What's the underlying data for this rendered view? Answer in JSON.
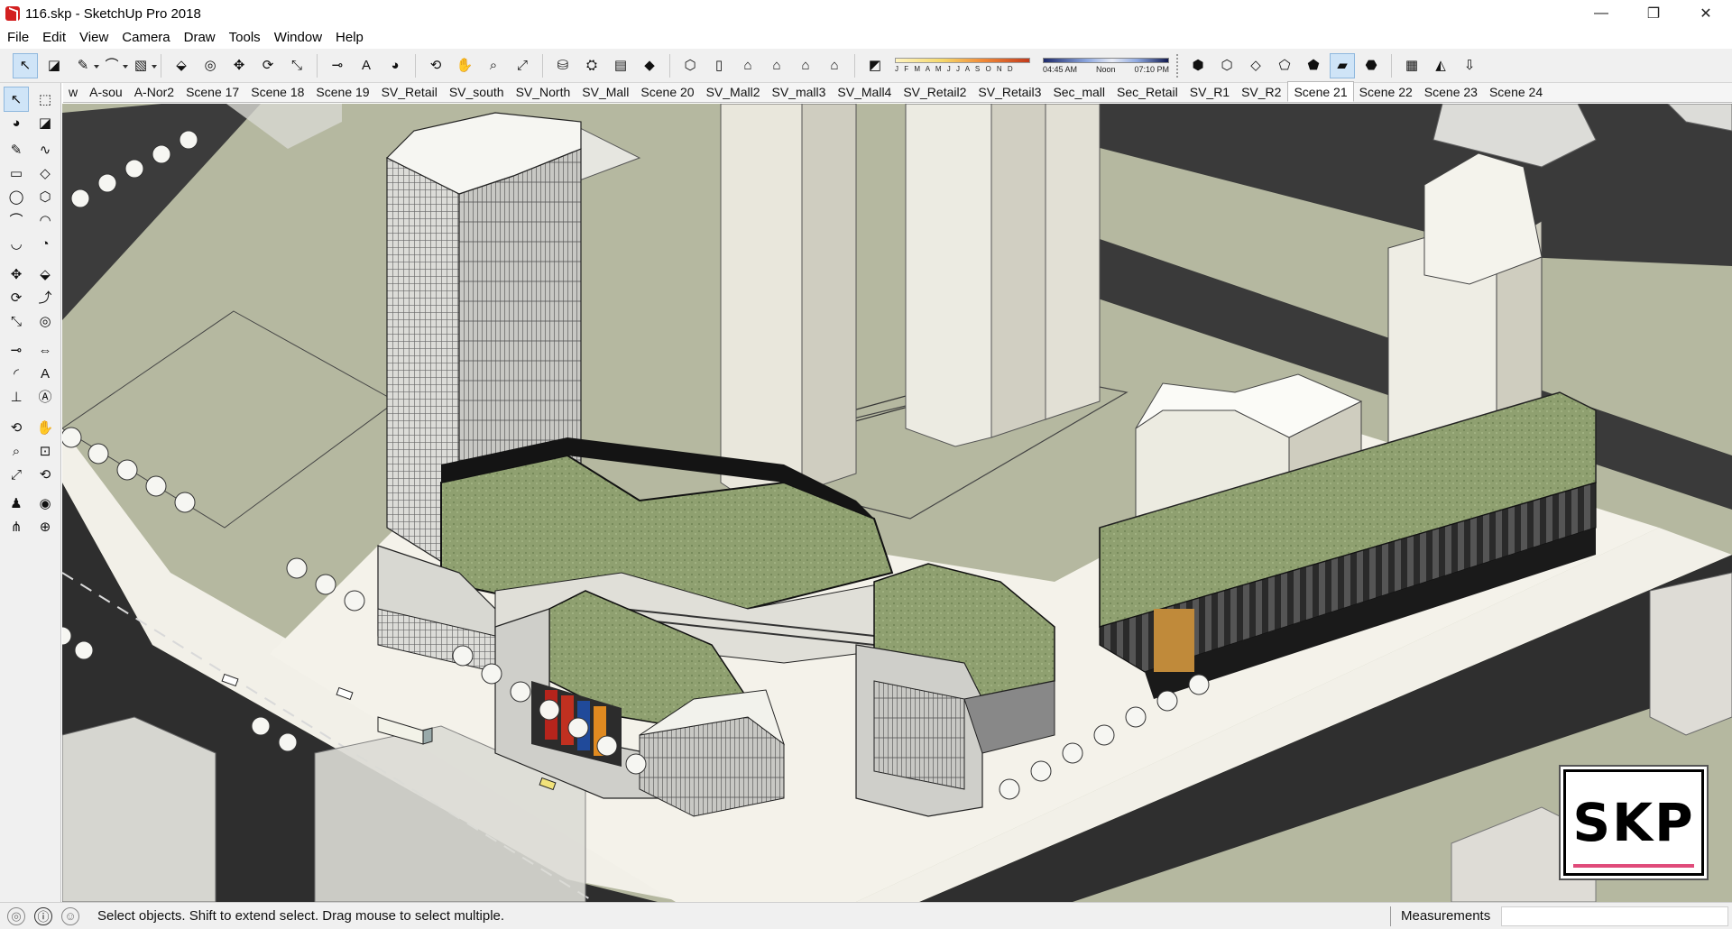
{
  "window": {
    "title": "116.skp - SketchUp Pro 2018",
    "controls": {
      "minimize": "—",
      "maximize": "❐",
      "close": "✕"
    }
  },
  "menu": [
    "File",
    "Edit",
    "View",
    "Camera",
    "Draw",
    "Tools",
    "Window",
    "Help"
  ],
  "toolbar": {
    "tools": [
      {
        "name": "select-tool-icon",
        "glyph": "↖",
        "selected": true
      },
      {
        "name": "eraser-tool-icon",
        "glyph": "◪"
      },
      {
        "name": "line-tool-icon",
        "glyph": "✎",
        "dropdown": true
      },
      {
        "name": "arc-tool-icon",
        "glyph": "⌒",
        "dropdown": true
      },
      {
        "name": "shapes-tool-icon",
        "glyph": "▧",
        "dropdown": true
      },
      {
        "name": "push-pull-tool-icon",
        "glyph": "⬙"
      },
      {
        "name": "offset-tool-icon",
        "glyph": "◎"
      },
      {
        "name": "move-tool-icon",
        "glyph": "✥"
      },
      {
        "name": "rotate-tool-icon",
        "glyph": "⟳"
      },
      {
        "name": "scale-tool-icon",
        "glyph": "⤡"
      },
      {
        "name": "tape-measure-icon",
        "glyph": "⊸"
      },
      {
        "name": "text-tool-icon",
        "glyph": "A"
      },
      {
        "name": "paint-bucket-icon",
        "glyph": "◕"
      },
      {
        "name": "orbit-tool-icon",
        "glyph": "⟲"
      },
      {
        "name": "pan-tool-icon",
        "glyph": "✋"
      },
      {
        "name": "zoom-tool-icon",
        "glyph": "⌕"
      },
      {
        "name": "zoom-extents-icon",
        "glyph": "⤢"
      },
      {
        "name": "warehouse-icon",
        "glyph": "⛁"
      },
      {
        "name": "extension-warehouse-icon",
        "glyph": "⛭"
      },
      {
        "name": "send-to-layout-icon",
        "glyph": "▤"
      },
      {
        "name": "ruby-console-icon",
        "glyph": "◆"
      },
      {
        "name": "view-iso-icon",
        "glyph": "⬡"
      },
      {
        "name": "view-top-icon",
        "glyph": "▯"
      },
      {
        "name": "view-front-icon",
        "glyph": "⌂"
      },
      {
        "name": "view-right-icon",
        "glyph": "⌂"
      },
      {
        "name": "view-back-icon",
        "glyph": "⌂"
      },
      {
        "name": "view-left-icon",
        "glyph": "⌂"
      }
    ],
    "shadows": {
      "months": "J F M A M J J A S O N D",
      "time_start": "04:45 AM",
      "time_mid": "Noon",
      "time_end": "07:10 PM"
    },
    "styles": [
      {
        "name": "xray-style-icon",
        "glyph": "⬢"
      },
      {
        "name": "back-edges-style-icon",
        "glyph": "⬡"
      },
      {
        "name": "wireframe-style-icon",
        "glyph": "◇"
      },
      {
        "name": "hidden-line-style-icon",
        "glyph": "⬠"
      },
      {
        "name": "shaded-style-icon",
        "glyph": "⬟"
      },
      {
        "name": "shaded-textures-style-icon",
        "glyph": "▰",
        "selected": true
      },
      {
        "name": "monochrome-style-icon",
        "glyph": "⬣"
      },
      {
        "name": "geo-location-icon",
        "glyph": "▦"
      },
      {
        "name": "sandbox-icon",
        "glyph": "◭"
      },
      {
        "name": "footprints-icon",
        "glyph": "⇩"
      }
    ]
  },
  "scenes": [
    "w",
    "A-sou",
    "A-Nor2",
    "Scene 17",
    "Scene 18",
    "Scene 19",
    "SV_Retail",
    "SV_south",
    "SV_North",
    "SV_Mall",
    "Scene 20",
    "SV_Mall2",
    "SV_mall3",
    "SV_Mall4",
    "SV_Retail2",
    "SV_Retail3",
    "Sec_mall",
    "Sec_Retail",
    "SV_R1",
    "SV_R2",
    "Scene 21",
    "Scene 22",
    "Scene 23",
    "Scene 24"
  ],
  "active_scene": "Scene 21",
  "left_tools": [
    [
      "select-icon|↖",
      "component-icon|⬚"
    ],
    [
      "paint-icon|◕",
      "eraser-icon|◪"
    ],
    [
      "line-icon|✎",
      "freehand-icon|∿"
    ],
    [
      "rectangle-icon|▭",
      "rotated-rectangle-icon|◇"
    ],
    [
      "circle-icon|◯",
      "polygon-icon|⬡"
    ],
    [
      "arc-icon|⌒",
      "two-point-arc-icon|◠"
    ],
    [
      "three-point-arc-icon|◡",
      "pie-icon|◔"
    ],
    [
      "move-icon|✥",
      "push-pull-icon|⬙"
    ],
    [
      "rotate-icon|⟳",
      "follow-me-icon|⤴"
    ],
    [
      "scale-icon|⤡",
      "offset-icon|◎"
    ],
    [
      "tape-measure-icon|⊸",
      "dimension-icon|⇔"
    ],
    [
      "protractor-icon|◜",
      "text-icon|A"
    ],
    [
      "axes-icon|⊥",
      "3d-text-icon|Ⓐ"
    ],
    [
      "orbit-icon|⟲",
      "pan-icon|✋"
    ],
    [
      "zoom-icon|⌕",
      "zoom-window-icon|⊡"
    ],
    [
      "zoom-extents-icon|⤢",
      "previous-view-icon|⟲"
    ],
    [
      "position-camera-icon|♟",
      "look-around-icon|◉"
    ],
    [
      "walk-icon|⋔",
      "section-plane-icon|⊕"
    ]
  ],
  "status": {
    "message": "Select objects. Shift to extend select. Drag mouse to select multiple.",
    "measurements_label": "Measurements",
    "measurements_value": ""
  },
  "badge": "SKP",
  "colors": {
    "ground": "#b5b8a0",
    "road": "#3a3a3a",
    "plaza": "#f4f2ea",
    "green_roof": "#8fa070",
    "tower_light": "#eae8dc",
    "accent_selected": "#cfe4f7"
  }
}
